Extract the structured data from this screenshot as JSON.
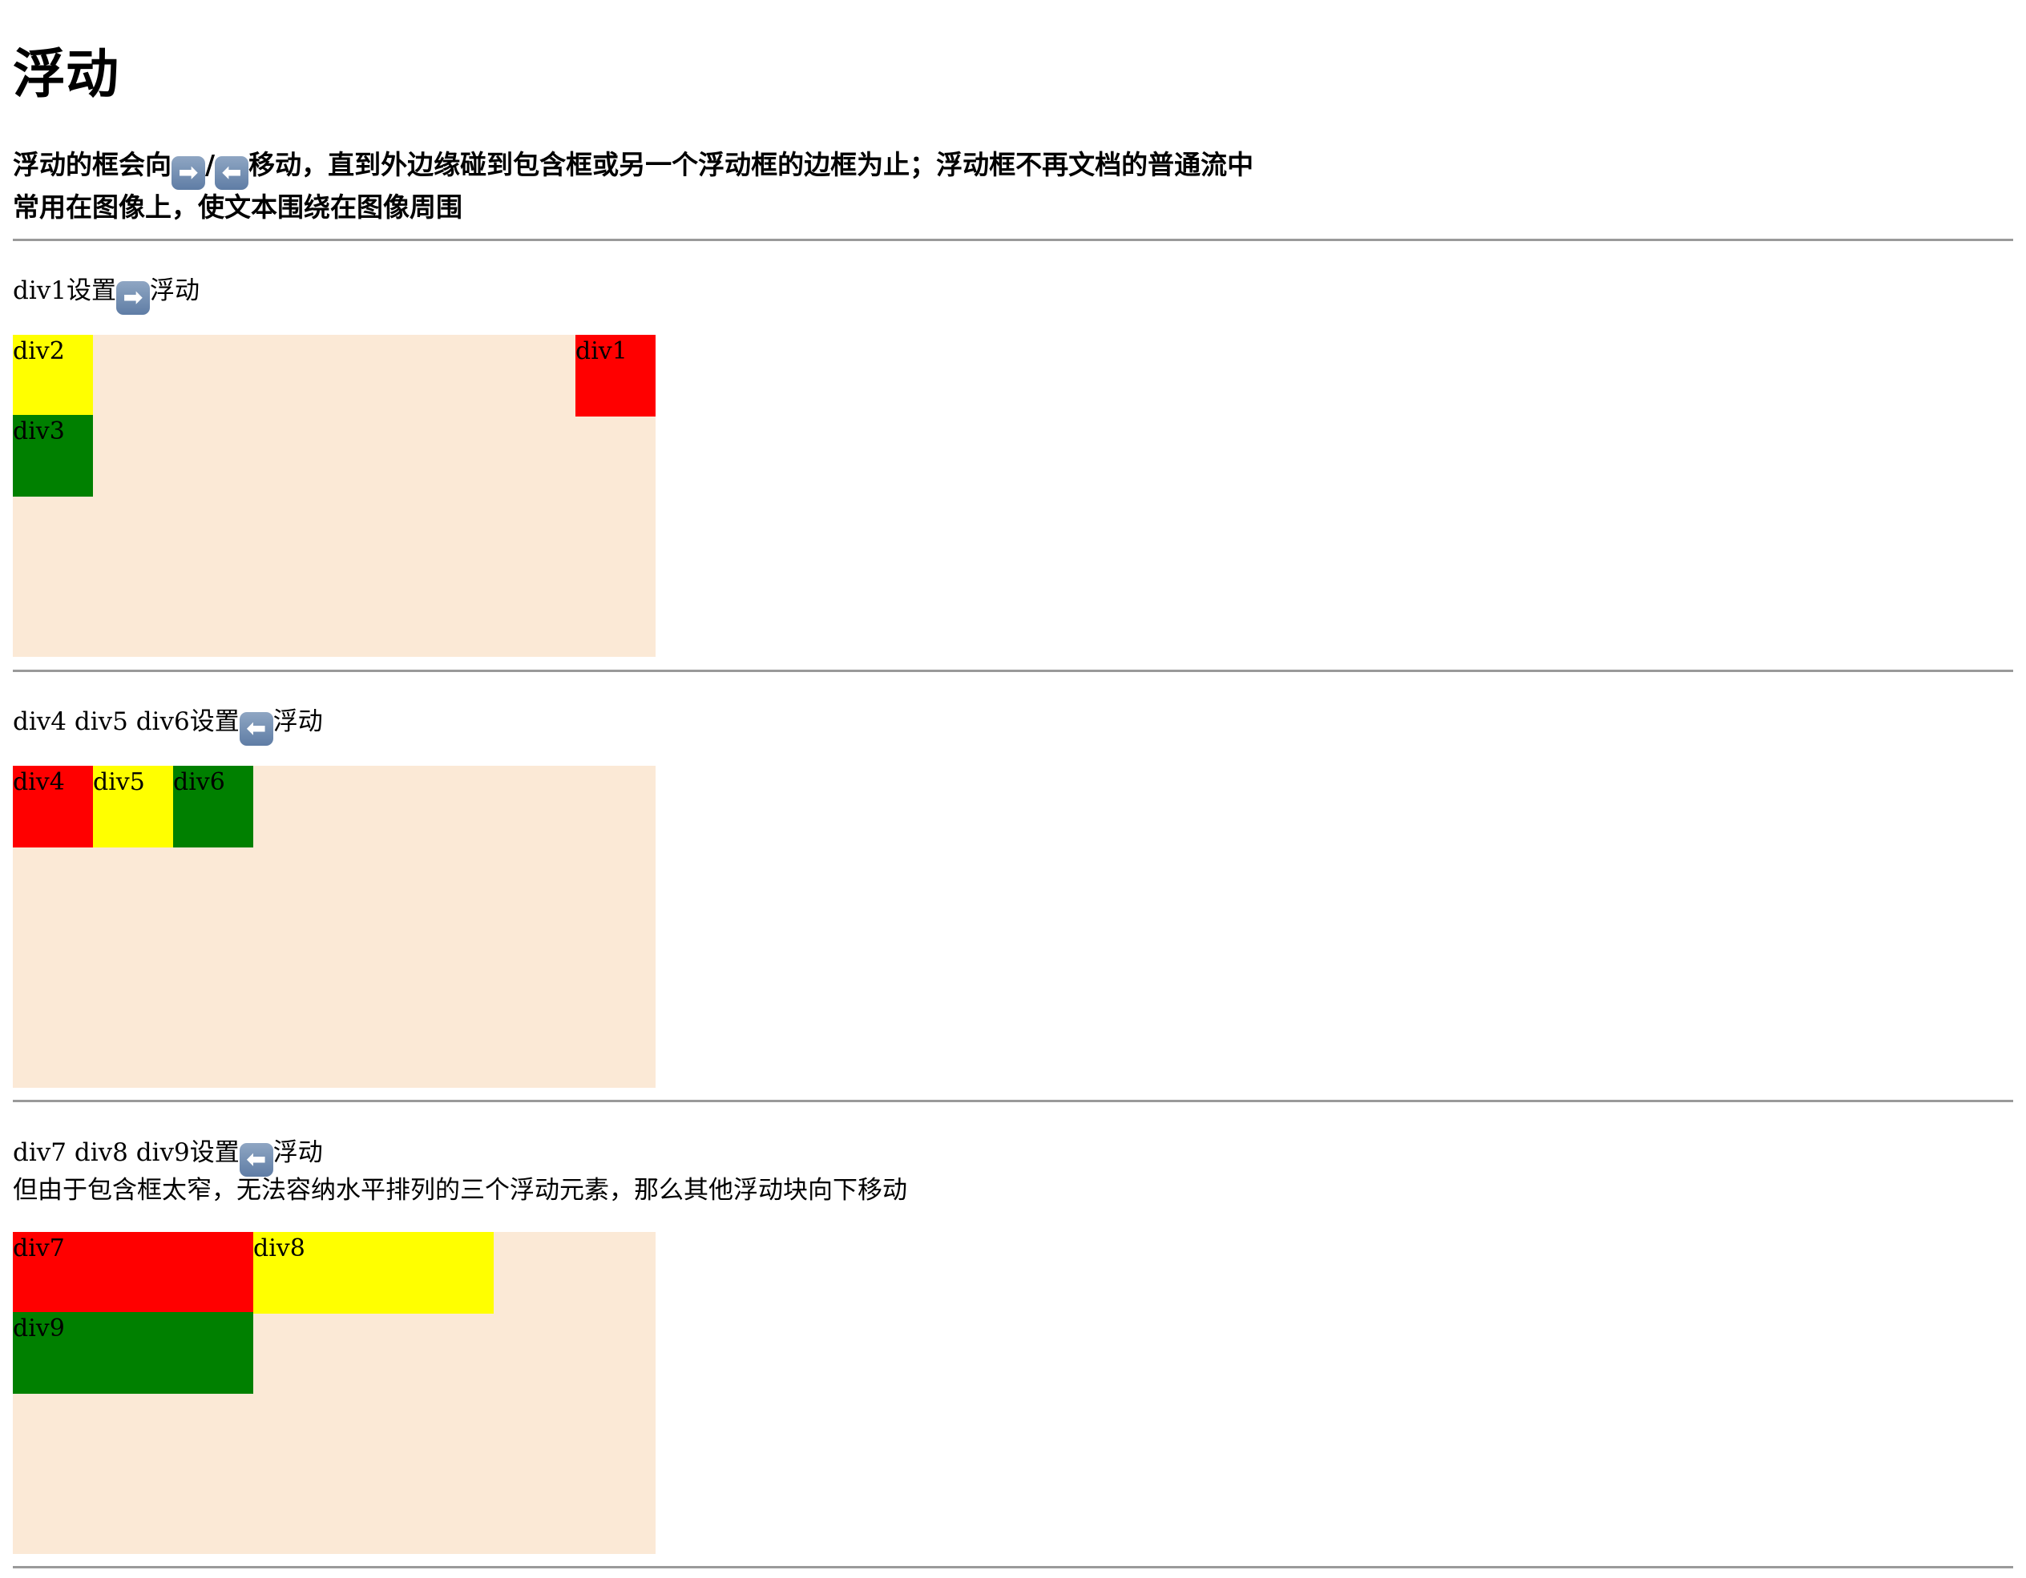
{
  "title": "浮动",
  "intro": {
    "line1_a": "浮动的框会向",
    "arrow_right": "➡",
    "slash": "/",
    "arrow_left": "⬅",
    "line1_b": "移动，直到外边缘碰到包含框或另一个浮动框的边框为止；浮动框不再文档的普通流中",
    "line2": "常用在图像上，使文本围绕在图像周围"
  },
  "section1": {
    "caption_a": "div1设置",
    "arrow": "➡",
    "caption_b": "浮动",
    "boxes": {
      "div1": "div1",
      "div2": "div2",
      "div3": "div3"
    }
  },
  "section2": {
    "caption_a": "div4 div5 div6设置",
    "arrow": "⬅",
    "caption_b": "浮动",
    "boxes": {
      "div4": "div4",
      "div5": "div5",
      "div6": "div6"
    }
  },
  "section3": {
    "caption_a": "div7 div8 div9设置",
    "arrow": "⬅",
    "caption_b": "浮动",
    "note": "但由于包含框太窄，无法容纳水平排列的三个浮动元素，那么其他浮动块向下移动",
    "boxes": {
      "div7": "div7",
      "div8": "div8",
      "div9": "div9"
    }
  },
  "colors": {
    "container_bg": "#fbe9d6",
    "red": "#ff0000",
    "yellow": "#ffff00",
    "green": "#008000",
    "rule": "#9a9a9a"
  }
}
